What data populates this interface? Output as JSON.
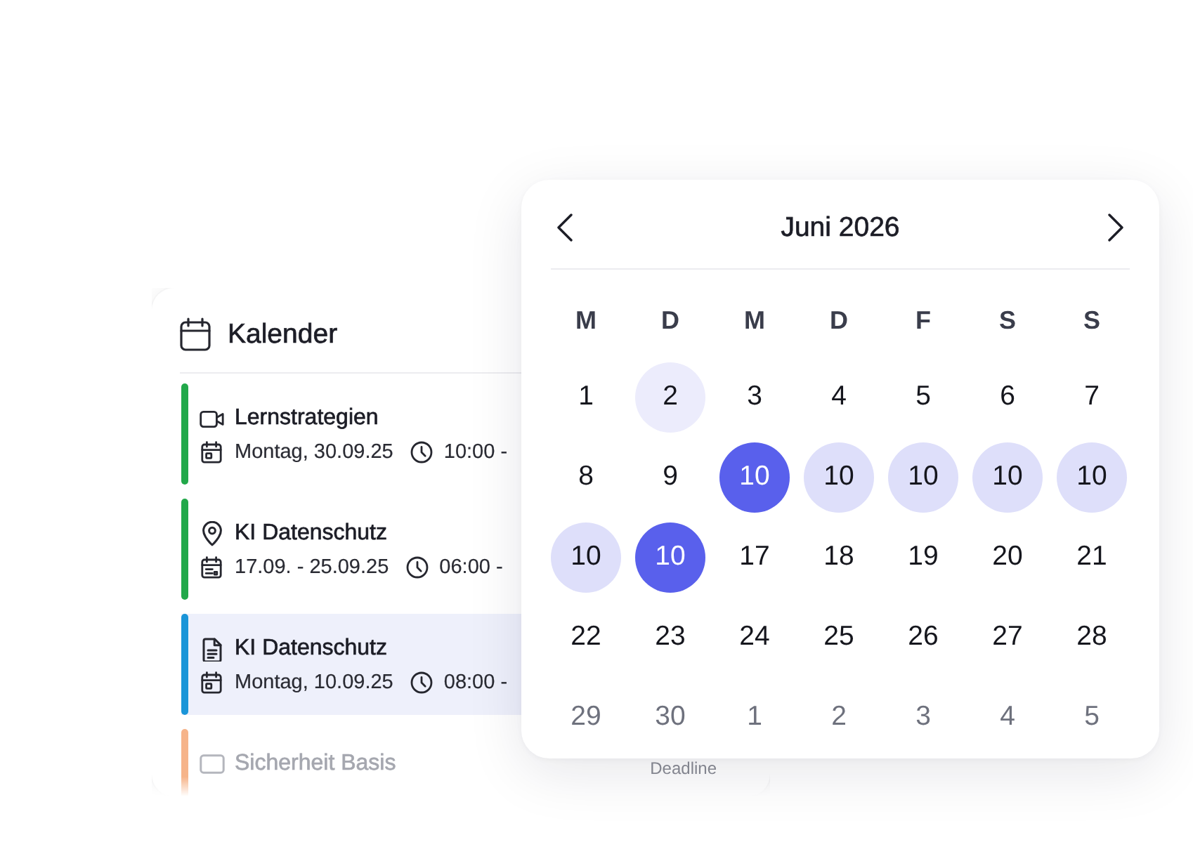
{
  "panel": {
    "title": "Kalender",
    "events": [
      {
        "kind": "video",
        "title": "Lernstrategien",
        "date": {
          "kind": "day",
          "text": "Montag, 30.09.25"
        },
        "time": "10:00 -",
        "color": "#22a84a",
        "selected": false,
        "dimmed": false
      },
      {
        "kind": "location",
        "title": "KI Datenschutz",
        "date": {
          "kind": "range",
          "text": "17.09. - 25.09.25"
        },
        "time": "06:00 -",
        "color": "#22a84a",
        "selected": false,
        "dimmed": false
      },
      {
        "kind": "document",
        "title": "KI Datenschutz",
        "date": {
          "kind": "day",
          "text": "Montag, 10.09.25"
        },
        "time": "08:00 -",
        "color": "#1b95d8",
        "selected": true,
        "dimmed": false
      },
      {
        "kind": "frame",
        "title": "Sicherheit Basis",
        "badge": "Deadline",
        "color": "#f6b48a",
        "selected": false,
        "dimmed": true
      }
    ]
  },
  "calendar": {
    "title": "Juni 2026",
    "weekdays": [
      "M",
      "D",
      "M",
      "D",
      "F",
      "S",
      "S"
    ],
    "weeks": [
      [
        {
          "label": "1",
          "selected": false,
          "in_range": false,
          "today": false,
          "muted": false
        },
        {
          "label": "2",
          "selected": false,
          "in_range": false,
          "today": true,
          "muted": false
        },
        {
          "label": "3",
          "selected": false,
          "in_range": false,
          "today": false,
          "muted": false
        },
        {
          "label": "4",
          "selected": false,
          "in_range": false,
          "today": false,
          "muted": false
        },
        {
          "label": "5",
          "selected": false,
          "in_range": false,
          "today": false,
          "muted": false
        },
        {
          "label": "6",
          "selected": false,
          "in_range": false,
          "today": false,
          "muted": false
        },
        {
          "label": "7",
          "selected": false,
          "in_range": false,
          "today": false,
          "muted": false
        }
      ],
      [
        {
          "label": "8",
          "selected": false,
          "in_range": false,
          "today": false,
          "muted": false
        },
        {
          "label": "9",
          "selected": false,
          "in_range": false,
          "today": false,
          "muted": false
        },
        {
          "label": "10",
          "selected": true,
          "in_range": false,
          "today": false,
          "muted": false
        },
        {
          "label": "10",
          "selected": false,
          "in_range": true,
          "today": false,
          "muted": false
        },
        {
          "label": "10",
          "selected": false,
          "in_range": true,
          "today": false,
          "muted": false
        },
        {
          "label": "10",
          "selected": false,
          "in_range": true,
          "today": false,
          "muted": false
        },
        {
          "label": "10",
          "selected": false,
          "in_range": true,
          "today": false,
          "muted": false
        }
      ],
      [
        {
          "label": "10",
          "selected": false,
          "in_range": true,
          "today": false,
          "muted": false
        },
        {
          "label": "10",
          "selected": true,
          "in_range": false,
          "today": false,
          "muted": false
        },
        {
          "label": "17",
          "selected": false,
          "in_range": false,
          "today": false,
          "muted": false
        },
        {
          "label": "18",
          "selected": false,
          "in_range": false,
          "today": false,
          "muted": false
        },
        {
          "label": "19",
          "selected": false,
          "in_range": false,
          "today": false,
          "muted": false
        },
        {
          "label": "20",
          "selected": false,
          "in_range": false,
          "today": false,
          "muted": false
        },
        {
          "label": "21",
          "selected": false,
          "in_range": false,
          "today": false,
          "muted": false
        }
      ],
      [
        {
          "label": "22",
          "selected": false,
          "in_range": false,
          "today": false,
          "muted": false
        },
        {
          "label": "23",
          "selected": false,
          "in_range": false,
          "today": false,
          "muted": false
        },
        {
          "label": "24",
          "selected": false,
          "in_range": false,
          "today": false,
          "muted": false
        },
        {
          "label": "25",
          "selected": false,
          "in_range": false,
          "today": false,
          "muted": false
        },
        {
          "label": "26",
          "selected": false,
          "in_range": false,
          "today": false,
          "muted": false
        },
        {
          "label": "27",
          "selected": false,
          "in_range": false,
          "today": false,
          "muted": false
        },
        {
          "label": "28",
          "selected": false,
          "in_range": false,
          "today": false,
          "muted": false
        }
      ],
      [
        {
          "label": "29",
          "selected": false,
          "in_range": false,
          "today": false,
          "muted": true
        },
        {
          "label": "30",
          "selected": false,
          "in_range": false,
          "today": false,
          "muted": true
        },
        {
          "label": "1",
          "selected": false,
          "in_range": false,
          "today": false,
          "muted": true
        },
        {
          "label": "2",
          "selected": false,
          "in_range": false,
          "today": false,
          "muted": true
        },
        {
          "label": "3",
          "selected": false,
          "in_range": false,
          "today": false,
          "muted": true
        },
        {
          "label": "4",
          "selected": false,
          "in_range": false,
          "today": false,
          "muted": true
        },
        {
          "label": "5",
          "selected": false,
          "in_range": false,
          "today": false,
          "muted": true
        }
      ]
    ]
  }
}
